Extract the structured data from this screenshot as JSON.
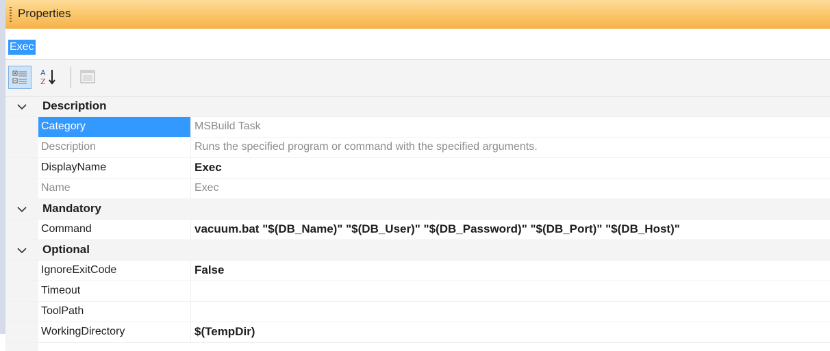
{
  "window": {
    "title": "Properties"
  },
  "object_selector": {
    "selected": "Exec"
  },
  "toolbar": {
    "categorized_icon": "categorized-view-icon",
    "alphabetical_icon": "alphabetical-sort-icon",
    "property_pages_icon": "property-pages-icon"
  },
  "categories": {
    "description": {
      "label": "Description",
      "rows": {
        "category": {
          "name": "Category",
          "value": "MSBuild Task"
        },
        "description": {
          "name": "Description",
          "value": "Runs the specified program or command with the specified arguments."
        },
        "display_name": {
          "name": "DisplayName",
          "value": "Exec"
        },
        "name": {
          "name": "Name",
          "value": "Exec"
        }
      }
    },
    "mandatory": {
      "label": "Mandatory",
      "rows": {
        "command": {
          "name": "Command",
          "value": "vacuum.bat \"$(DB_Name)\" \"$(DB_User)\" \"$(DB_Password)\" \"$(DB_Port)\" \"$(DB_Host)\""
        }
      }
    },
    "optional": {
      "label": "Optional",
      "rows": {
        "ignore_exit_code": {
          "name": "IgnoreExitCode",
          "value": "False"
        },
        "timeout": {
          "name": "Timeout",
          "value": ""
        },
        "tool_path": {
          "name": "ToolPath",
          "value": ""
        },
        "working_directory": {
          "name": "WorkingDirectory",
          "value": "$(TempDir)"
        }
      }
    }
  },
  "colors": {
    "title_gradient_top": "#fcdc99",
    "title_gradient_bottom": "#f6b14b",
    "selection": "#3399ff",
    "readonly_text": "#8d8d8d"
  }
}
